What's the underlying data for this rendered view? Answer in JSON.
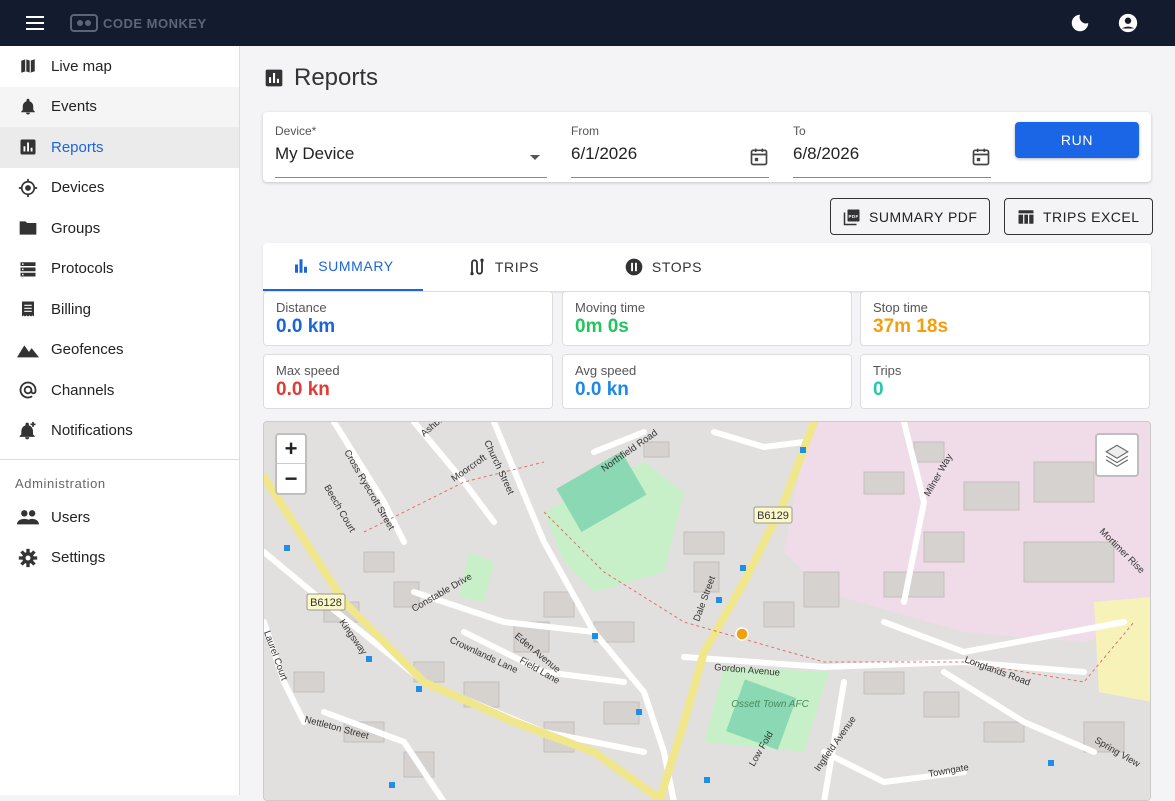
{
  "appbar": {
    "logo_text": "CODE MONKEY",
    "dark_mode_icon": "moon-icon",
    "account_icon": "account-circle-icon"
  },
  "sidebar": {
    "items": [
      {
        "label": "Live map",
        "icon": "map-icon"
      },
      {
        "label": "Events",
        "icon": "bell-icon"
      },
      {
        "label": "Reports",
        "icon": "bar-chart-icon"
      },
      {
        "label": "Devices",
        "icon": "gps-icon"
      },
      {
        "label": "Groups",
        "icon": "folder-icon"
      },
      {
        "label": "Protocols",
        "icon": "storage-icon"
      },
      {
        "label": "Billing",
        "icon": "receipt-icon"
      },
      {
        "label": "Geofences",
        "icon": "terrain-icon"
      },
      {
        "label": "Channels",
        "icon": "at-icon"
      },
      {
        "label": "Notifications",
        "icon": "notification-add-icon"
      }
    ],
    "admin_label": "Administration",
    "admin_items": [
      {
        "label": "Users",
        "icon": "people-icon"
      },
      {
        "label": "Settings",
        "icon": "gear-icon"
      }
    ]
  },
  "page": {
    "title": "Reports"
  },
  "filters": {
    "device_label": "Device*",
    "device_value": "My Device",
    "from_label": "From",
    "from_value": "6/1/2026",
    "to_label": "To",
    "to_value": "6/8/2026",
    "run_label": "RUN"
  },
  "exports": {
    "summary_pdf": "SUMMARY PDF",
    "trips_excel": "TRIPS EXCEL"
  },
  "tabs": [
    {
      "label": "SUMMARY",
      "icon": "bar-chart-icon"
    },
    {
      "label": "TRIPS",
      "icon": "route-icon"
    },
    {
      "label": "STOPS",
      "icon": "pause-circle-icon"
    }
  ],
  "stats": [
    {
      "label": "Distance",
      "value": "0.0 km",
      "color": "#1a66d6"
    },
    {
      "label": "Moving time",
      "value": "0m 0s",
      "color": "#22c55e"
    },
    {
      "label": "Stop time",
      "value": "37m 18s",
      "color": "#f59e0b"
    },
    {
      "label": "Max speed",
      "value": "0.0 kn",
      "color": "#e53935"
    },
    {
      "label": "Avg speed",
      "value": "0.0 kn",
      "color": "#1e88e5"
    },
    {
      "label": "Trips",
      "value": "0",
      "color": "#26c6a6"
    }
  ],
  "map": {
    "zoom_in": "+",
    "zoom_out": "−",
    "road_refs": [
      "B6129",
      "B6128"
    ],
    "streets": [
      "Northfield Road",
      "Church Street",
      "Cross Ryecroft Street",
      "Ashbrook Close",
      "Moorcroft",
      "Beech Court",
      "Constable Drive",
      "Crownlands Lane",
      "Eden Avenue",
      "Field Lane",
      "Kingsway",
      "Laurel Court",
      "Nettleton Street",
      "Dale Street",
      "Gordon Avenue",
      "Milner Way",
      "Mortimer Rise",
      "Longlands Road",
      "Ingfield Avenue",
      "Towngate",
      "Spring View",
      "Low Fold"
    ],
    "place_label": "Ossett Town AFC"
  }
}
